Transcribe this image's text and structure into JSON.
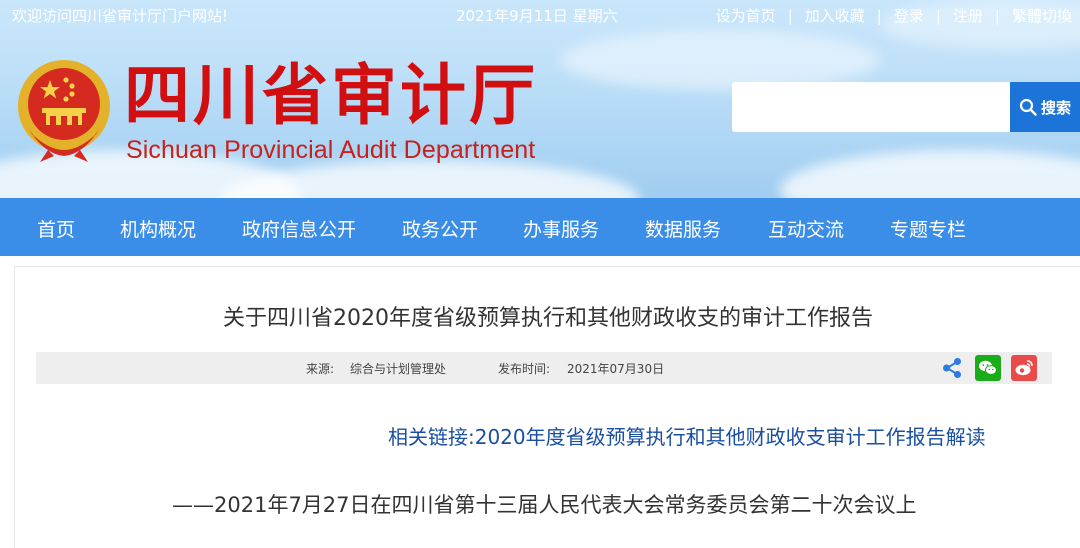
{
  "topbar": {
    "welcome": "欢迎访问四川省审计厅门户网站!",
    "date": "2021年9月11日 星期六",
    "links": [
      "设为首页",
      "加入收藏",
      "登录",
      "注册",
      "繁體切換"
    ],
    "separator": "|"
  },
  "header": {
    "title": "四川省审计厅",
    "subtitle": "Sichuan Provincial Audit Department",
    "emblem_icon": "national-emblem-icon"
  },
  "search": {
    "placeholder": "",
    "button_label": "搜索",
    "icon": "search-icon"
  },
  "nav": {
    "items": [
      "首页",
      "机构概况",
      "政府信息公开",
      "政务公开",
      "办事服务",
      "数据服务",
      "互动交流",
      "专题专栏"
    ]
  },
  "article": {
    "title": "关于四川省2020年度省级预算执行和其他财政收支的审计工作报告",
    "source_label": "来源:",
    "source": "综合与计划管理处",
    "date_label": "发布时间:",
    "date": "2021年07月30日",
    "related_link": "相关链接:2020年度省级预算执行和其他财政收支审计工作报告解读",
    "subtitle": "——2021年7月27日在四川省第十三届人民代表大会常务委员会第二十次会议上"
  },
  "share": {
    "icons": [
      "share-icon",
      "wechat-icon",
      "weibo-icon"
    ]
  },
  "colors": {
    "nav_bg": "#3b8ee8",
    "title_red": "#d10f10",
    "link_blue": "#1a4fa3",
    "search_btn": "#1d74d8"
  }
}
